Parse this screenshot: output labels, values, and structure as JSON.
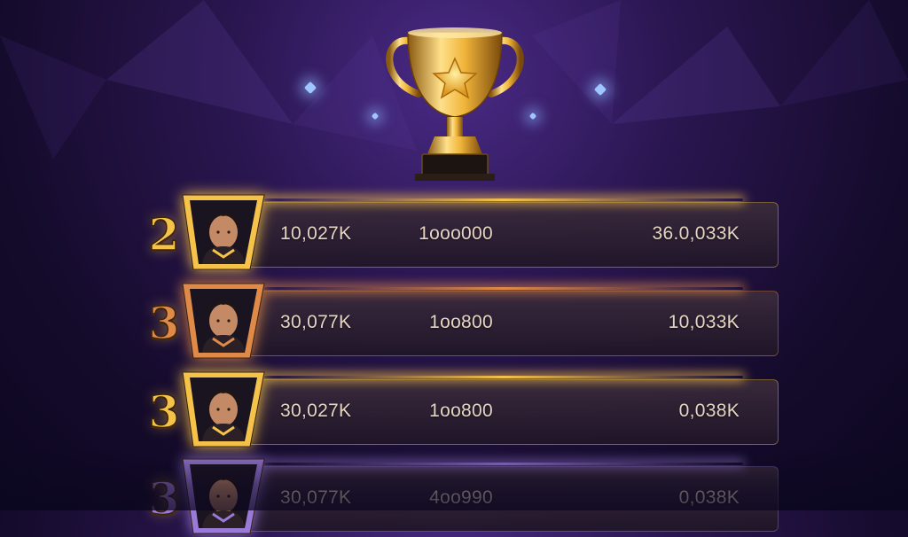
{
  "leaderboard": {
    "rows": [
      {
        "rank": "2",
        "tier": "gold",
        "col1": "10,027K",
        "col2": "1ooo000",
        "col3": "36.0,033K"
      },
      {
        "rank": "3",
        "tier": "bronze",
        "col1": "30,077K",
        "col2": "1oo800",
        "col3": "10,033K"
      },
      {
        "rank": "3",
        "tier": "gold",
        "col1": "30,027K",
        "col2": "1oo800",
        "col3": "0,038K"
      },
      {
        "rank": "3",
        "tier": "purple",
        "col1": "30,077K",
        "col2": "4oo990",
        "col3": "0,038K"
      }
    ]
  },
  "colors": {
    "gold": "#f5c24a",
    "bronze": "#e08a4a",
    "purple": "#9a7ad8",
    "text": "#e5d5c2",
    "background": "#2a1650"
  },
  "icons": [
    "trophy-icon",
    "star-icon",
    "player-avatar"
  ]
}
